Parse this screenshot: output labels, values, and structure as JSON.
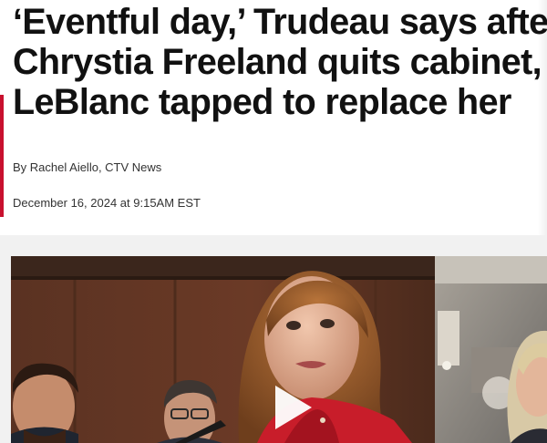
{
  "article": {
    "headline": "‘Eventful day,’ Trudeau says after\nChrystia Freeland quits cabinet,\nLeBlanc tapped to replace her",
    "byline": "By Rachel Aiello, CTV News",
    "timestamp": "December 16, 2024 at 9:15AM EST"
  },
  "media": {
    "play_icon": "play-icon",
    "accent_color": "#c8102e"
  }
}
